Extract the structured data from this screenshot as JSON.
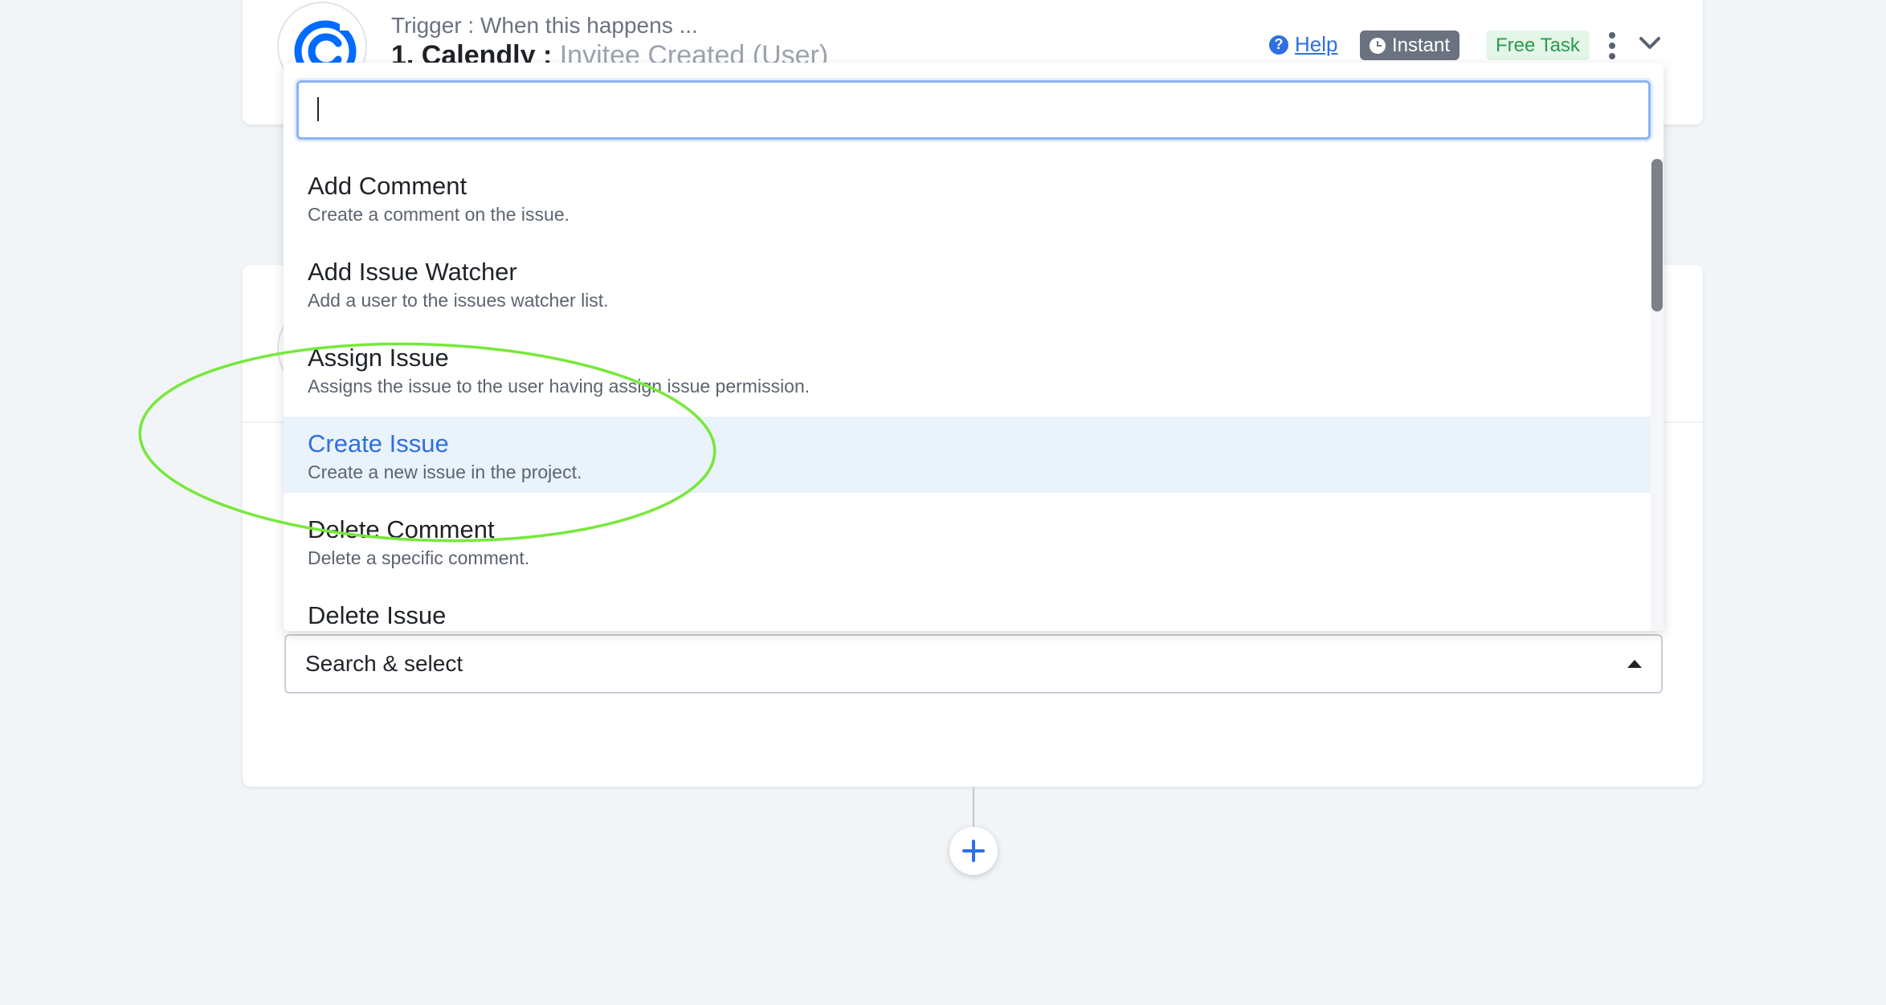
{
  "trigger": {
    "label": "Trigger : When this happens ...",
    "step_number": "1. Calendly : ",
    "event": "Invitee Created (User)",
    "help_label": "Help",
    "help_icon": "question-circle-icon",
    "instant_label": "Instant",
    "free_task_label": "Free Task",
    "logo_color": "#006BFF"
  },
  "dropdown": {
    "search_value": "",
    "options": [
      {
        "title": "Add Comment",
        "description": "Create a comment on the issue."
      },
      {
        "title": "Add Issue Watcher",
        "description": "Add a user to the issues watcher list."
      },
      {
        "title": "Assign Issue",
        "description": "Assigns the issue to the user having assign issue permission."
      },
      {
        "title": "Create Issue",
        "description": "Create a new issue in the project."
      },
      {
        "title": "Delete Comment",
        "description": "Delete a specific comment."
      },
      {
        "title": "Delete Issue",
        "description": ""
      }
    ],
    "highlighted_option": "Create Issue"
  },
  "action": {
    "select_placeholder": "Search & select"
  },
  "colors": {
    "accent": "#2f6fe0",
    "highlight_bg": "#eaf3fc",
    "annotation": "#77e83b",
    "free_badge_bg": "#e3f6e8",
    "free_badge_text": "#2d9a4f",
    "instant_badge_bg": "#6b7280"
  }
}
